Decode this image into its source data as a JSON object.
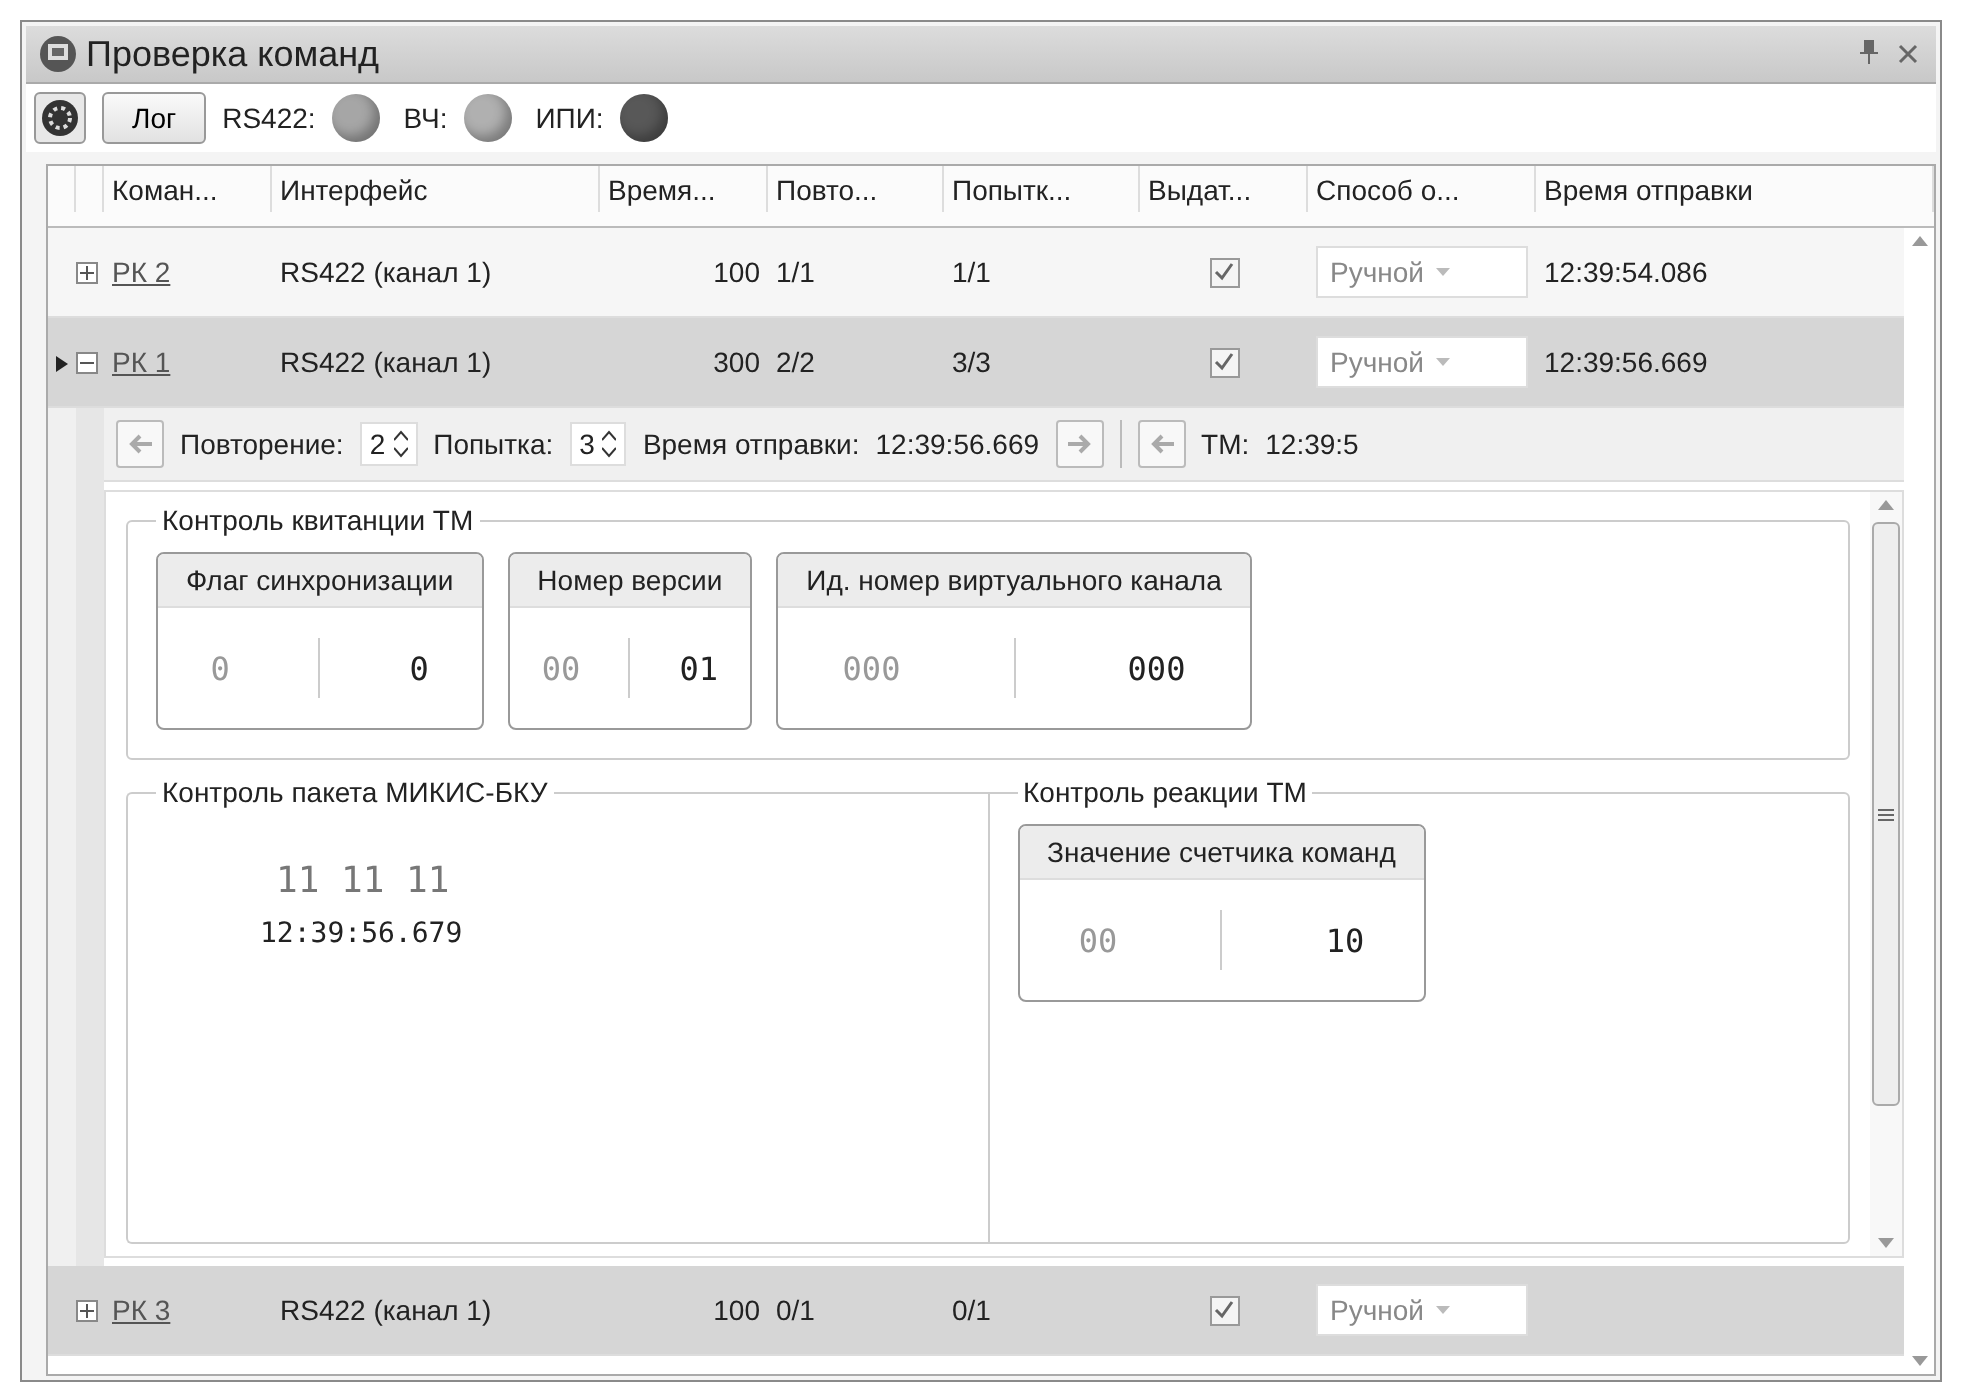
{
  "window": {
    "title": "Проверка команд"
  },
  "toolbar": {
    "log_button": "Лог",
    "indicators": [
      {
        "label": "RS422:",
        "color": "#a6a6a6"
      },
      {
        "label": "ВЧ:",
        "color": "#b0b0b0"
      },
      {
        "label": "ИПИ:",
        "color": "#585858"
      }
    ]
  },
  "table": {
    "columns": [
      "Коман...",
      "Интерфейс",
      "Время...",
      "Повто...",
      "Попытк...",
      "Выдат...",
      "Способ о...",
      "Время отправки"
    ],
    "rows": [
      {
        "name": "РК 2",
        "interface": "RS422 (канал 1)",
        "time": "100",
        "repeat": "1/1",
        "attempts": "1/1",
        "issued": true,
        "method": "Ручной",
        "sent_time": "12:39:54.086",
        "expanded": false,
        "current": false,
        "selected": false
      },
      {
        "name": "РК 1",
        "interface": "RS422 (канал 1)",
        "time": "300",
        "repeat": "2/2",
        "attempts": "3/3",
        "issued": true,
        "method": "Ручной",
        "sent_time": "12:39:56.669",
        "expanded": true,
        "current": true,
        "selected": true
      },
      {
        "name": "РК 3",
        "interface": "RS422 (канал 1)",
        "time": "100",
        "repeat": "0/1",
        "attempts": "0/1",
        "issued": true,
        "method": "Ручной",
        "expanded": false,
        "current": false,
        "selected": true
      }
    ]
  },
  "detail": {
    "nav": {
      "repeat_label": "Повторение:",
      "repeat_value": "2",
      "attempt_label": "Попытка:",
      "attempt_value": "3",
      "sent_label": "Время отправки:",
      "sent_value": "12:39:56.669",
      "tm_label": "ТМ:",
      "tm_value": "12:39:5"
    },
    "receipt_group": {
      "title": "Контроль квитанции ТМ",
      "cards": [
        {
          "title": "Флаг синхронизации",
          "expected": "0",
          "actual": "0"
        },
        {
          "title": "Номер версии",
          "expected": "00",
          "actual": "01"
        },
        {
          "title": "Ид. номер виртуального канала",
          "expected": "000",
          "actual": "000"
        }
      ]
    },
    "packet_group": {
      "title": "Контроль пакета МИКИС-БКУ",
      "bytes": "11 11 11",
      "time": "12:39:56.679"
    },
    "reaction_group": {
      "title": "Контроль реакции ТМ",
      "cards": [
        {
          "title": "Значение счетчика команд",
          "expected": "00",
          "actual": "10"
        }
      ]
    }
  }
}
